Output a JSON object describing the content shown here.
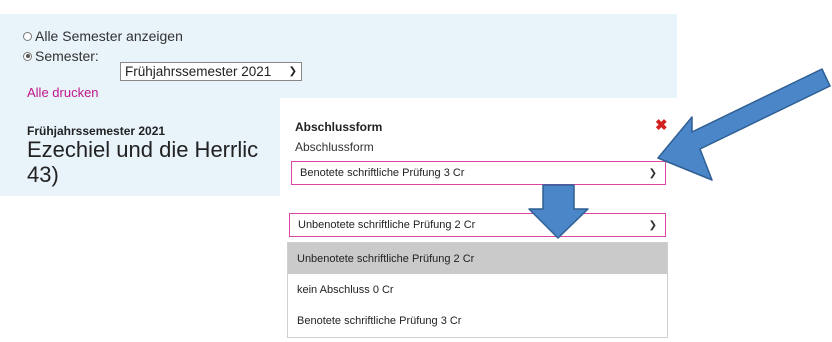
{
  "filter": {
    "option_all": "Alle Semester anzeigen",
    "option_semester": "Semester:",
    "semester_value": "Frühjahrssemester 2021",
    "print_all": "Alle drucken"
  },
  "course": {
    "semester": "Frühjahrssemester 2021",
    "title_line1": "Ezechiel und die Herrlic",
    "title_line2": "43)"
  },
  "dialog": {
    "title": "Abschlussform",
    "subtitle": "Abschlussform",
    "selected": "Benotete schriftliche Prüfung 3 Cr"
  },
  "dropdown": {
    "selected": "Unbenotete schriftliche Prüfung 2 Cr",
    "options": [
      "Unbenotete schriftliche Prüfung 2 Cr",
      "kein Abschluss 0 Cr",
      "Benotete schriftliche Prüfung 3 Cr"
    ]
  },
  "colors": {
    "panel": "#e8f3fa",
    "accent_pink": "#d946a8",
    "arrow_fill": "#4a86c8",
    "close": "#d32020"
  }
}
